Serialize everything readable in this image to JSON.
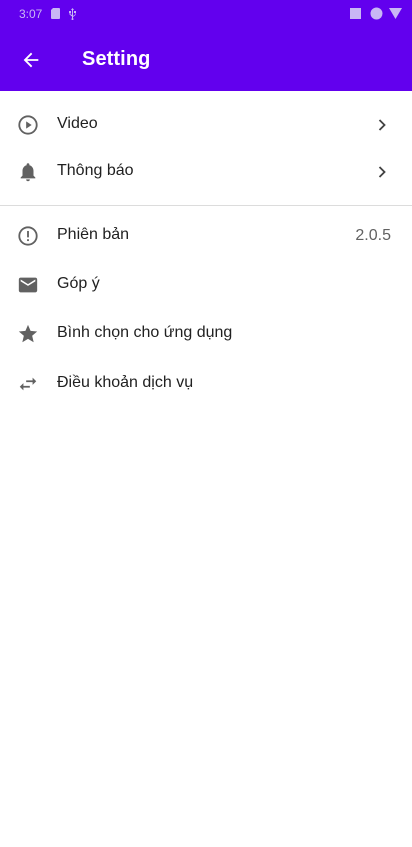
{
  "status_bar": {
    "time": "3:07"
  },
  "app_bar": {
    "title": "Setting",
    "back_icon": "arrow-back-icon"
  },
  "settings": {
    "group1": [
      {
        "label": "Video",
        "icon": "play-circle-icon",
        "trailing": "chevron-right-icon"
      },
      {
        "label": "Thông báo",
        "icon": "bell-icon",
        "trailing": "chevron-right-icon"
      }
    ],
    "group2": [
      {
        "label": "Phiên bản",
        "icon": "info-circle-icon",
        "value": "2.0.5"
      },
      {
        "label": "Góp ý",
        "icon": "mail-icon"
      },
      {
        "label": "Bình chọn cho ứng dụng",
        "icon": "star-icon"
      },
      {
        "label": "Điều khoản dịch vụ",
        "icon": "swap-arrows-icon"
      }
    ]
  },
  "colors": {
    "primary": "#6200ee",
    "icon": "#616161",
    "text": "#212121"
  }
}
